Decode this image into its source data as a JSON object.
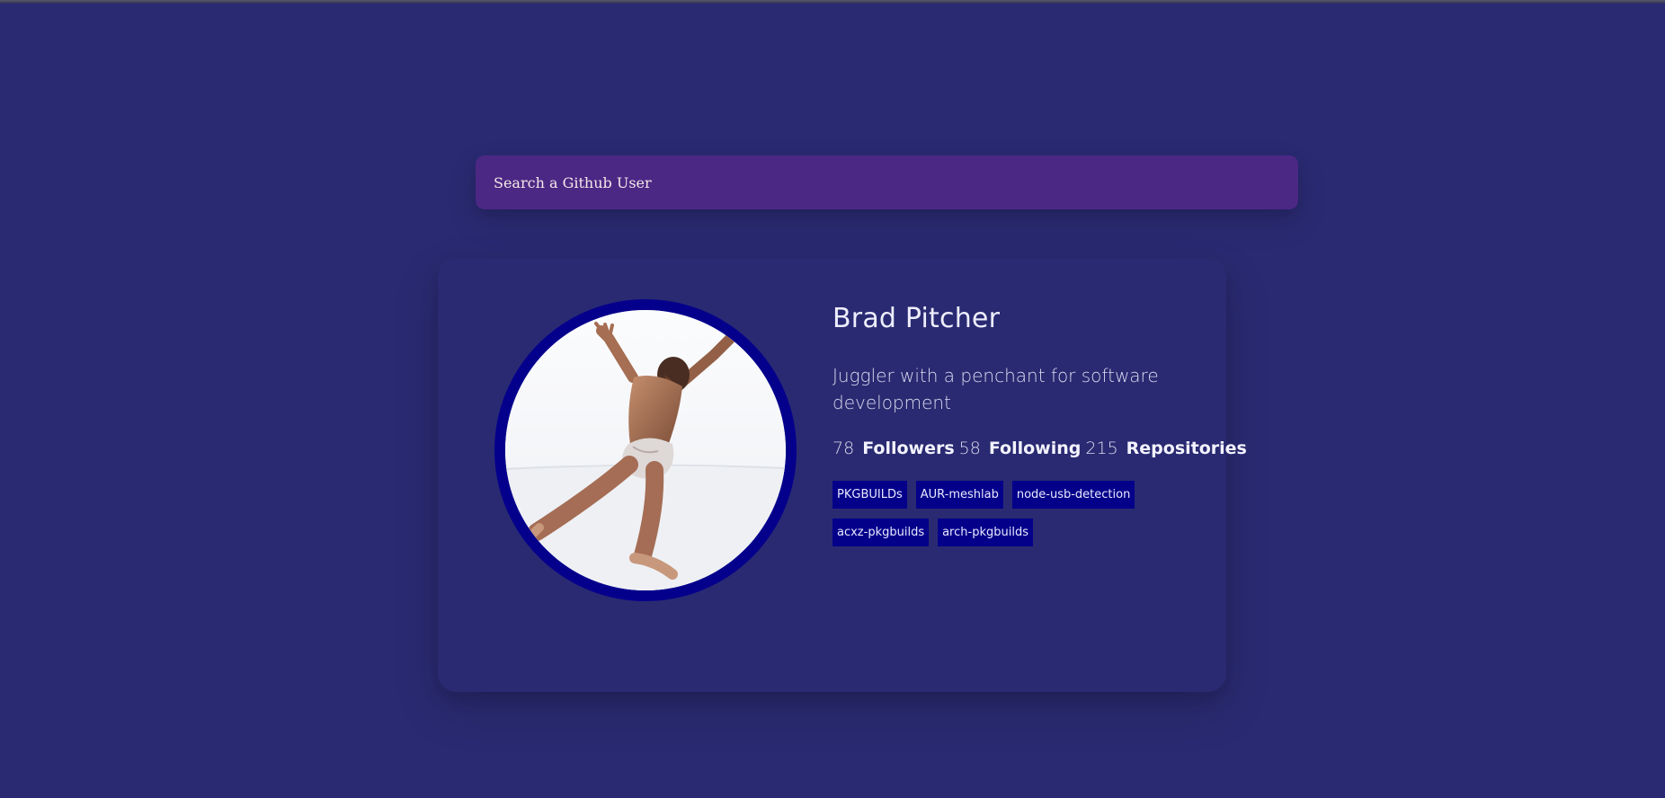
{
  "search": {
    "placeholder": "Search a Github User",
    "value": ""
  },
  "profile": {
    "name": "Brad Pitcher",
    "bio": "Juggler with a penchant for software development",
    "stats": {
      "followers_count": "78",
      "followers_label": "Followers",
      "following_count": "58",
      "following_label": "Following",
      "repositories_count": "215",
      "repositories_label": "Repositories"
    },
    "repos": [
      "PKGBUILDs",
      "AUR-meshlab",
      "node-usb-detection",
      "acxz-pkgbuilds",
      "arch-pkgbuilds"
    ],
    "avatar_icon": "user-avatar-photo"
  },
  "colors": {
    "background": "#2a2a72",
    "search_bar": "#4c2885",
    "avatar_border": "#05008c",
    "repo_tag": "#04008a"
  }
}
